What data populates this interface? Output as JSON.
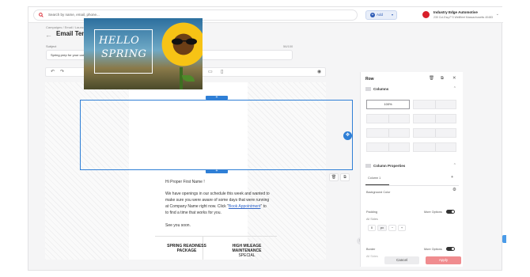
{
  "header": {
    "search_placeholder": "Search by name, email, phone...",
    "add_label": "Add",
    "account_name": "Industry Edge Automotive",
    "account_address": "230 Cul-Esq-P 5 Wellfleet Massachusetts 40483"
  },
  "breadcrumb": "Campaigns / Email / Launch Campaign",
  "page_title": "Email Template Editor",
  "subject": {
    "label": "Subject",
    "count": "56/100",
    "value": "Spring prep for your car 🌻 We have open bays this week."
  },
  "hero": {
    "line1": "HELLO",
    "line2": "SPRING"
  },
  "email_body": {
    "greeting": "Hi   Proper First Name  !",
    "p1": [
      "We have openings in our schedule this week and wanted to",
      "make sure you were aware of some days that were running",
      "at   Company Name   right now. Click \"",
      "to find a time that works for you."
    ],
    "link_text": "Book Appointment",
    "link_tail": "\" to",
    "see_you": "See you soon.",
    "col1_heading": [
      "SPRING READINESS",
      "PACKAGE"
    ],
    "col2_heading": [
      "HIGH MILEAGE",
      "MAINTENANCE",
      "SPECIAL"
    ]
  },
  "panel": {
    "title": "Row",
    "columns_heading": "Columns",
    "layout_selected": "100%",
    "column_properties_heading": "Column Properties",
    "column_tab": "Column 1",
    "background_color_label": "Background Color",
    "padding_label": "Padding",
    "more_options_label": "More Options",
    "all_sides_label": "All Sides",
    "padding_value": "0",
    "padding_unit": "px",
    "border_label": "Border",
    "border_more_options": "More Options",
    "border_all_sides": "All Sides",
    "cancel_label": "Cancel",
    "apply_label": "Apply"
  },
  "colors": {
    "accent": "#2f7fd6",
    "apply": "#f08c8f",
    "brand_red": "#d81f2a"
  }
}
